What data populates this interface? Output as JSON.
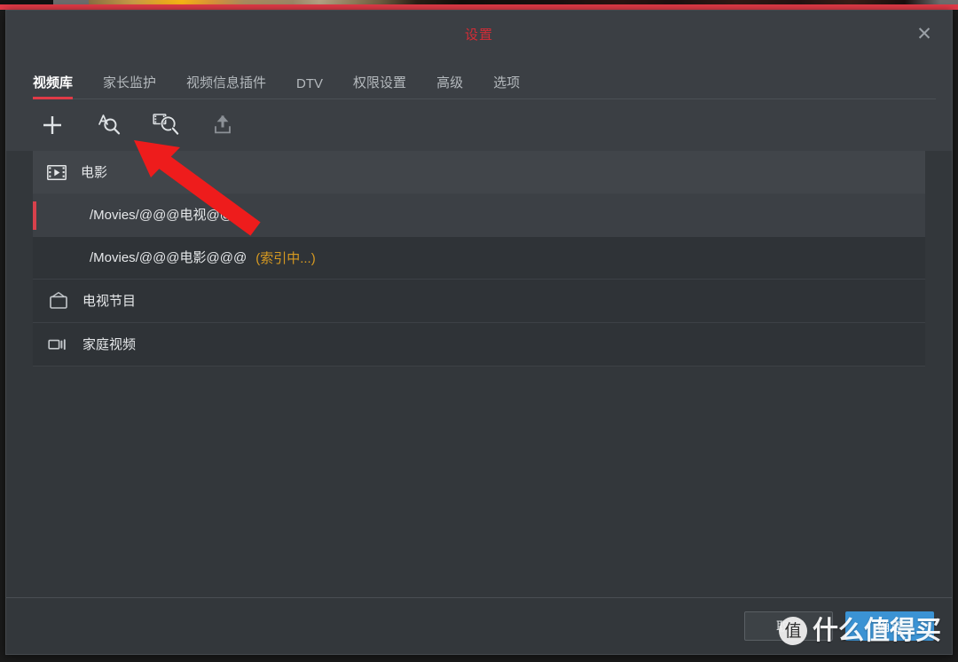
{
  "window": {
    "title": "设置",
    "close_label": "✕",
    "close_icon": "close-icon",
    "accent_red": "#e03a47",
    "title_color": "#d32c36",
    "dialog_bg": "#33373b",
    "header_bg": "#3b3f44"
  },
  "tabs": [
    {
      "label": "视频库",
      "active": true
    },
    {
      "label": "家长监护",
      "active": false
    },
    {
      "label": "视频信息插件",
      "active": false
    },
    {
      "label": "DTV",
      "active": false
    },
    {
      "label": "权限设置",
      "active": false
    },
    {
      "label": "高级",
      "active": false
    },
    {
      "label": "选项",
      "active": false
    }
  ],
  "toolbar": [
    {
      "name": "add-library-button",
      "icon": "plus-icon"
    },
    {
      "name": "text-search-button",
      "icon": "text-search-icon"
    },
    {
      "name": "video-search-button",
      "icon": "film-search-icon"
    },
    {
      "name": "upload-button",
      "icon": "upload-icon"
    }
  ],
  "library_list": [
    {
      "label": "电影",
      "icon": "film-play-icon",
      "type": "library-header",
      "selected": false,
      "status": ""
    },
    {
      "label": "/Movies/@@@电视@@",
      "icon": "",
      "type": "folder-selected",
      "selected": true,
      "status": ""
    },
    {
      "label": "/Movies/@@@电影@@@",
      "icon": "",
      "type": "folder",
      "selected": false,
      "status": "(索引中...)"
    },
    {
      "label": "电视节目",
      "icon": "tv-icon",
      "type": "library",
      "selected": false,
      "status": ""
    },
    {
      "label": "家庭视频",
      "icon": "camcorder-icon",
      "type": "library",
      "selected": false,
      "status": ""
    }
  ],
  "status_color": "#d79a21",
  "footer": {
    "cancel_label": "取消",
    "ok_label": "确定",
    "primary_color": "#3b93d4"
  },
  "watermark": {
    "logo_char": "值",
    "text": "什么值得买"
  },
  "annotation": {
    "arrow_color": "#ee1c1c",
    "points_to": "film-search-icon"
  }
}
